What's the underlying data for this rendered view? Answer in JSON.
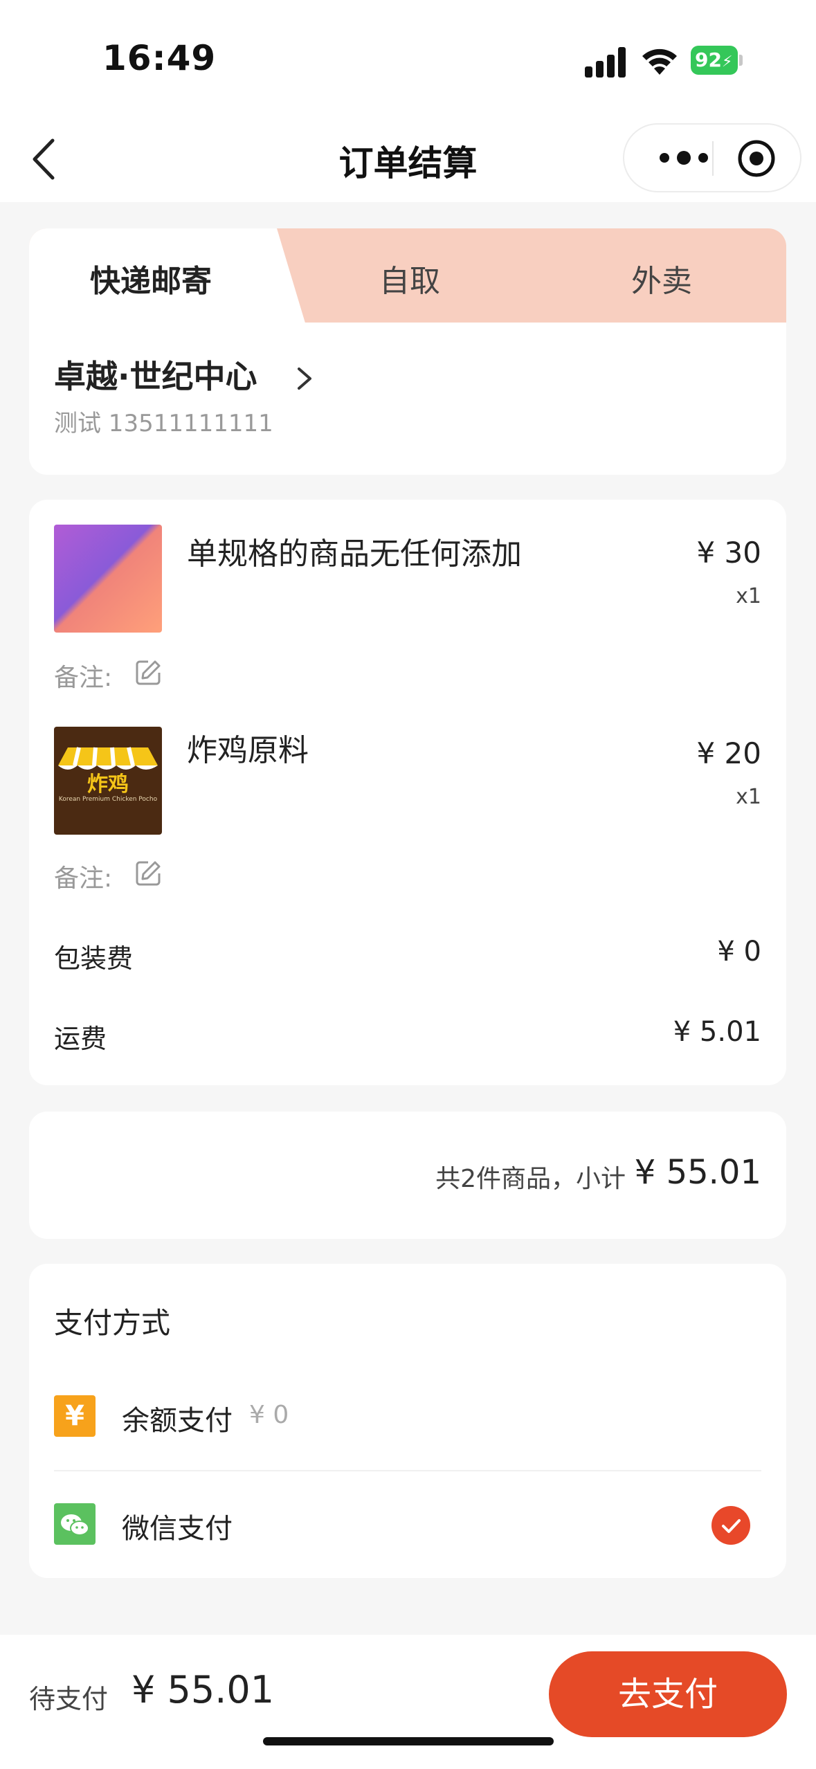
{
  "status_bar": {
    "time": "16:49",
    "battery": "92"
  },
  "nav": {
    "title": "订单结算",
    "icons": [
      "back-icon",
      "more-icon",
      "target-icon"
    ]
  },
  "delivery": {
    "tabs": [
      {
        "label": "快递邮寄",
        "active": true
      },
      {
        "label": "自取",
        "active": false
      },
      {
        "label": "外卖",
        "active": false
      }
    ],
    "address_name": "卓越·世纪中心",
    "contact": "测试 13511111111"
  },
  "goods": [
    {
      "name": "单规格的商品无任何添加",
      "price": "¥ 30",
      "qty": "x1",
      "remark_label": "备注:"
    },
    {
      "name": "炸鸡原料",
      "price": "¥ 20",
      "qty": "x1",
      "remark_label": "备注:",
      "thumb_text": "炸鸡",
      "thumb_subtext": "Korean Premium Chicken Pocho"
    }
  ],
  "fees": [
    {
      "label": "包装费",
      "value": "¥ 0"
    },
    {
      "label": "运费",
      "value": "¥ 5.01"
    }
  ],
  "summary": {
    "text": "共2件商品，小计",
    "value": "¥ 55.01"
  },
  "payment": {
    "title": "支付方式",
    "methods": [
      {
        "label": "余额支付",
        "balance": "¥ 0",
        "selected": false,
        "icon": "yuan-icon",
        "color": "#f7a21b"
      },
      {
        "label": "微信支付",
        "selected": true,
        "icon": "wechat-icon",
        "color": "#5bc15f"
      }
    ]
  },
  "footer": {
    "due_label": "待支付",
    "due_value": "¥ 55.01",
    "pay_button": "去支付"
  },
  "colors": {
    "accent": "#e54a27",
    "tab_bg": "#f8cfc0",
    "page_bg": "#f6f6f6"
  }
}
